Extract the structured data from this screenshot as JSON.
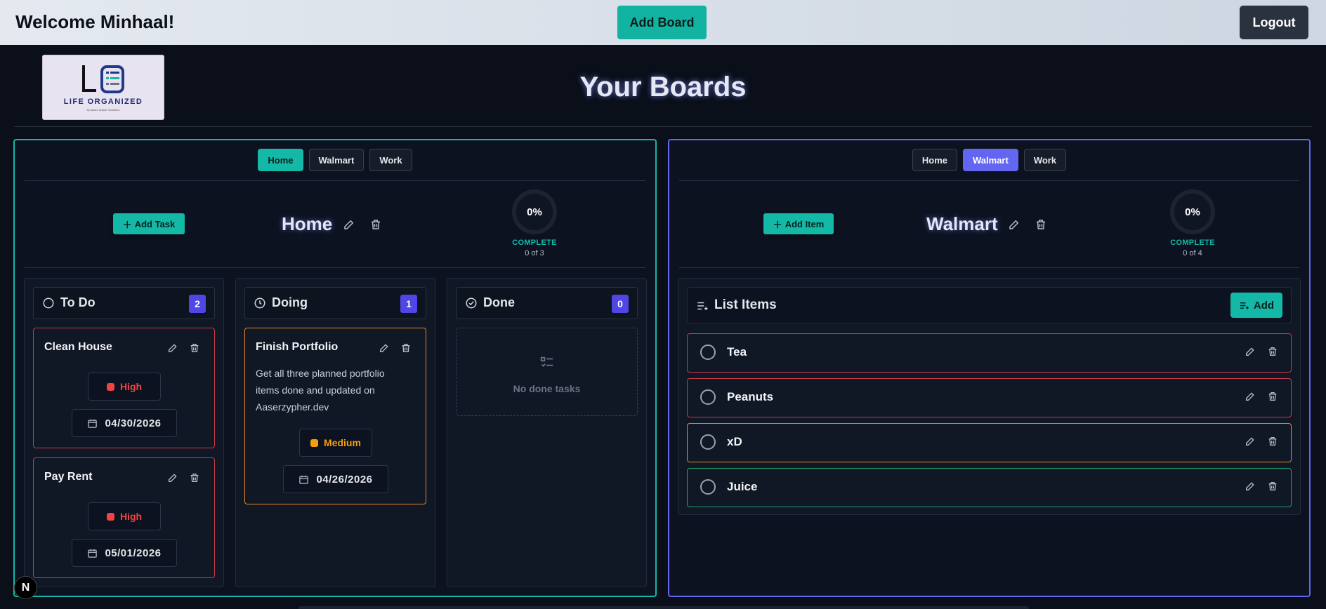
{
  "header": {
    "welcome": "Welcome Minhaal!",
    "add_board_label": "Add Board",
    "logout_label": "Logout"
  },
  "logo": {
    "text": "LIFE ORGANIZED",
    "subtext": "by Aaser Zypher Solutions"
  },
  "page_title": "Your Boards",
  "colors": {
    "teal": "#14b8a6",
    "indigo": "#6366f1",
    "high": "#ef4444",
    "medium": "#f59e0b",
    "low": "#22c55e"
  },
  "left_board": {
    "tabs": [
      "Home",
      "Walmart",
      "Work"
    ],
    "active_tab": "Home",
    "add_label": "Add Task",
    "name": "Home",
    "progress_percent": "0%",
    "progress_label": "COMPLETE",
    "progress_count": "0 of 3",
    "columns": [
      {
        "title": "To Do",
        "count": "2",
        "icon": "circle-icon",
        "cards": [
          {
            "title": "Clean House",
            "priority": "High",
            "date": "04/30/2026"
          },
          {
            "title": "Pay Rent",
            "priority": "High",
            "date": "05/01/2026"
          }
        ]
      },
      {
        "title": "Doing",
        "count": "1",
        "icon": "clock-icon",
        "cards": [
          {
            "title": "Finish Portfolio",
            "description": "Get all three planned portfolio items done and updated on Aaserzypher.dev",
            "priority": "Medium",
            "date": "04/26/2026"
          }
        ]
      },
      {
        "title": "Done",
        "count": "0",
        "icon": "check-circle-icon",
        "empty_text": "No done tasks"
      }
    ]
  },
  "right_board": {
    "tabs": [
      "Home",
      "Walmart",
      "Work"
    ],
    "active_tab": "Walmart",
    "add_label": "Add Item",
    "name": "Walmart",
    "progress_percent": "0%",
    "progress_label": "COMPLETE",
    "progress_count": "0 of 4",
    "list_title": "List Items",
    "list_add_label": "Add",
    "items": [
      {
        "label": "Tea",
        "priority": "High"
      },
      {
        "label": "Peanuts",
        "priority": "High"
      },
      {
        "label": "xD",
        "priority": "Medium"
      },
      {
        "label": "Juice",
        "priority": "Low"
      }
    ]
  },
  "dev_badge": "N"
}
